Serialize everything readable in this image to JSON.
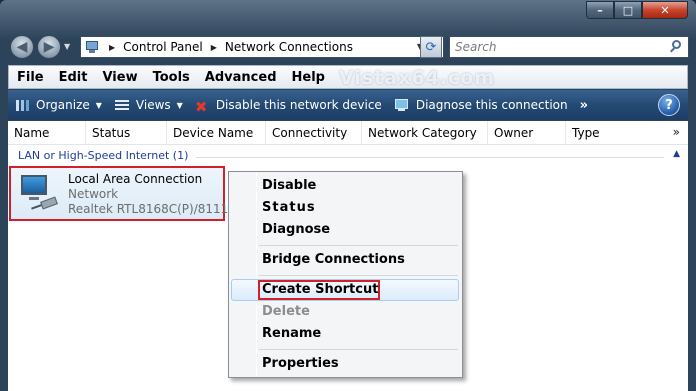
{
  "navigation": {
    "address_crumbs": [
      "Control Panel",
      "Network Connections"
    ],
    "search_placeholder": "Search"
  },
  "menubar": {
    "items": [
      "File",
      "Edit",
      "View",
      "Tools",
      "Advanced",
      "Help"
    ],
    "watermark": "Vistax64.com"
  },
  "commandbar": {
    "organize": "Organize",
    "views": "Views",
    "disable": "Disable this network device",
    "diagnose": "Diagnose this connection",
    "more": "»"
  },
  "columns": [
    "Name",
    "Status",
    "Device Name",
    "Connectivity",
    "Network Category",
    "Owner",
    "Type"
  ],
  "columns_more": "»",
  "group": {
    "label": "LAN or High-Speed Internet (1)"
  },
  "connection": {
    "name": "Local Area Connection",
    "status": "Network",
    "device": "Realtek RTL8168C(P)/8111C(..."
  },
  "context_menu": {
    "disable": "Disable",
    "status": "Status",
    "diagnose": "Diagnose",
    "bridge": "Bridge Connections",
    "create_shortcut": "Create Shortcut",
    "delete": "Delete",
    "rename": "Rename",
    "properties": "Properties"
  },
  "colors": {
    "highlight_outline": "#d0202a",
    "command_bar": "#244a74",
    "group_header": "#1e3d9a"
  }
}
